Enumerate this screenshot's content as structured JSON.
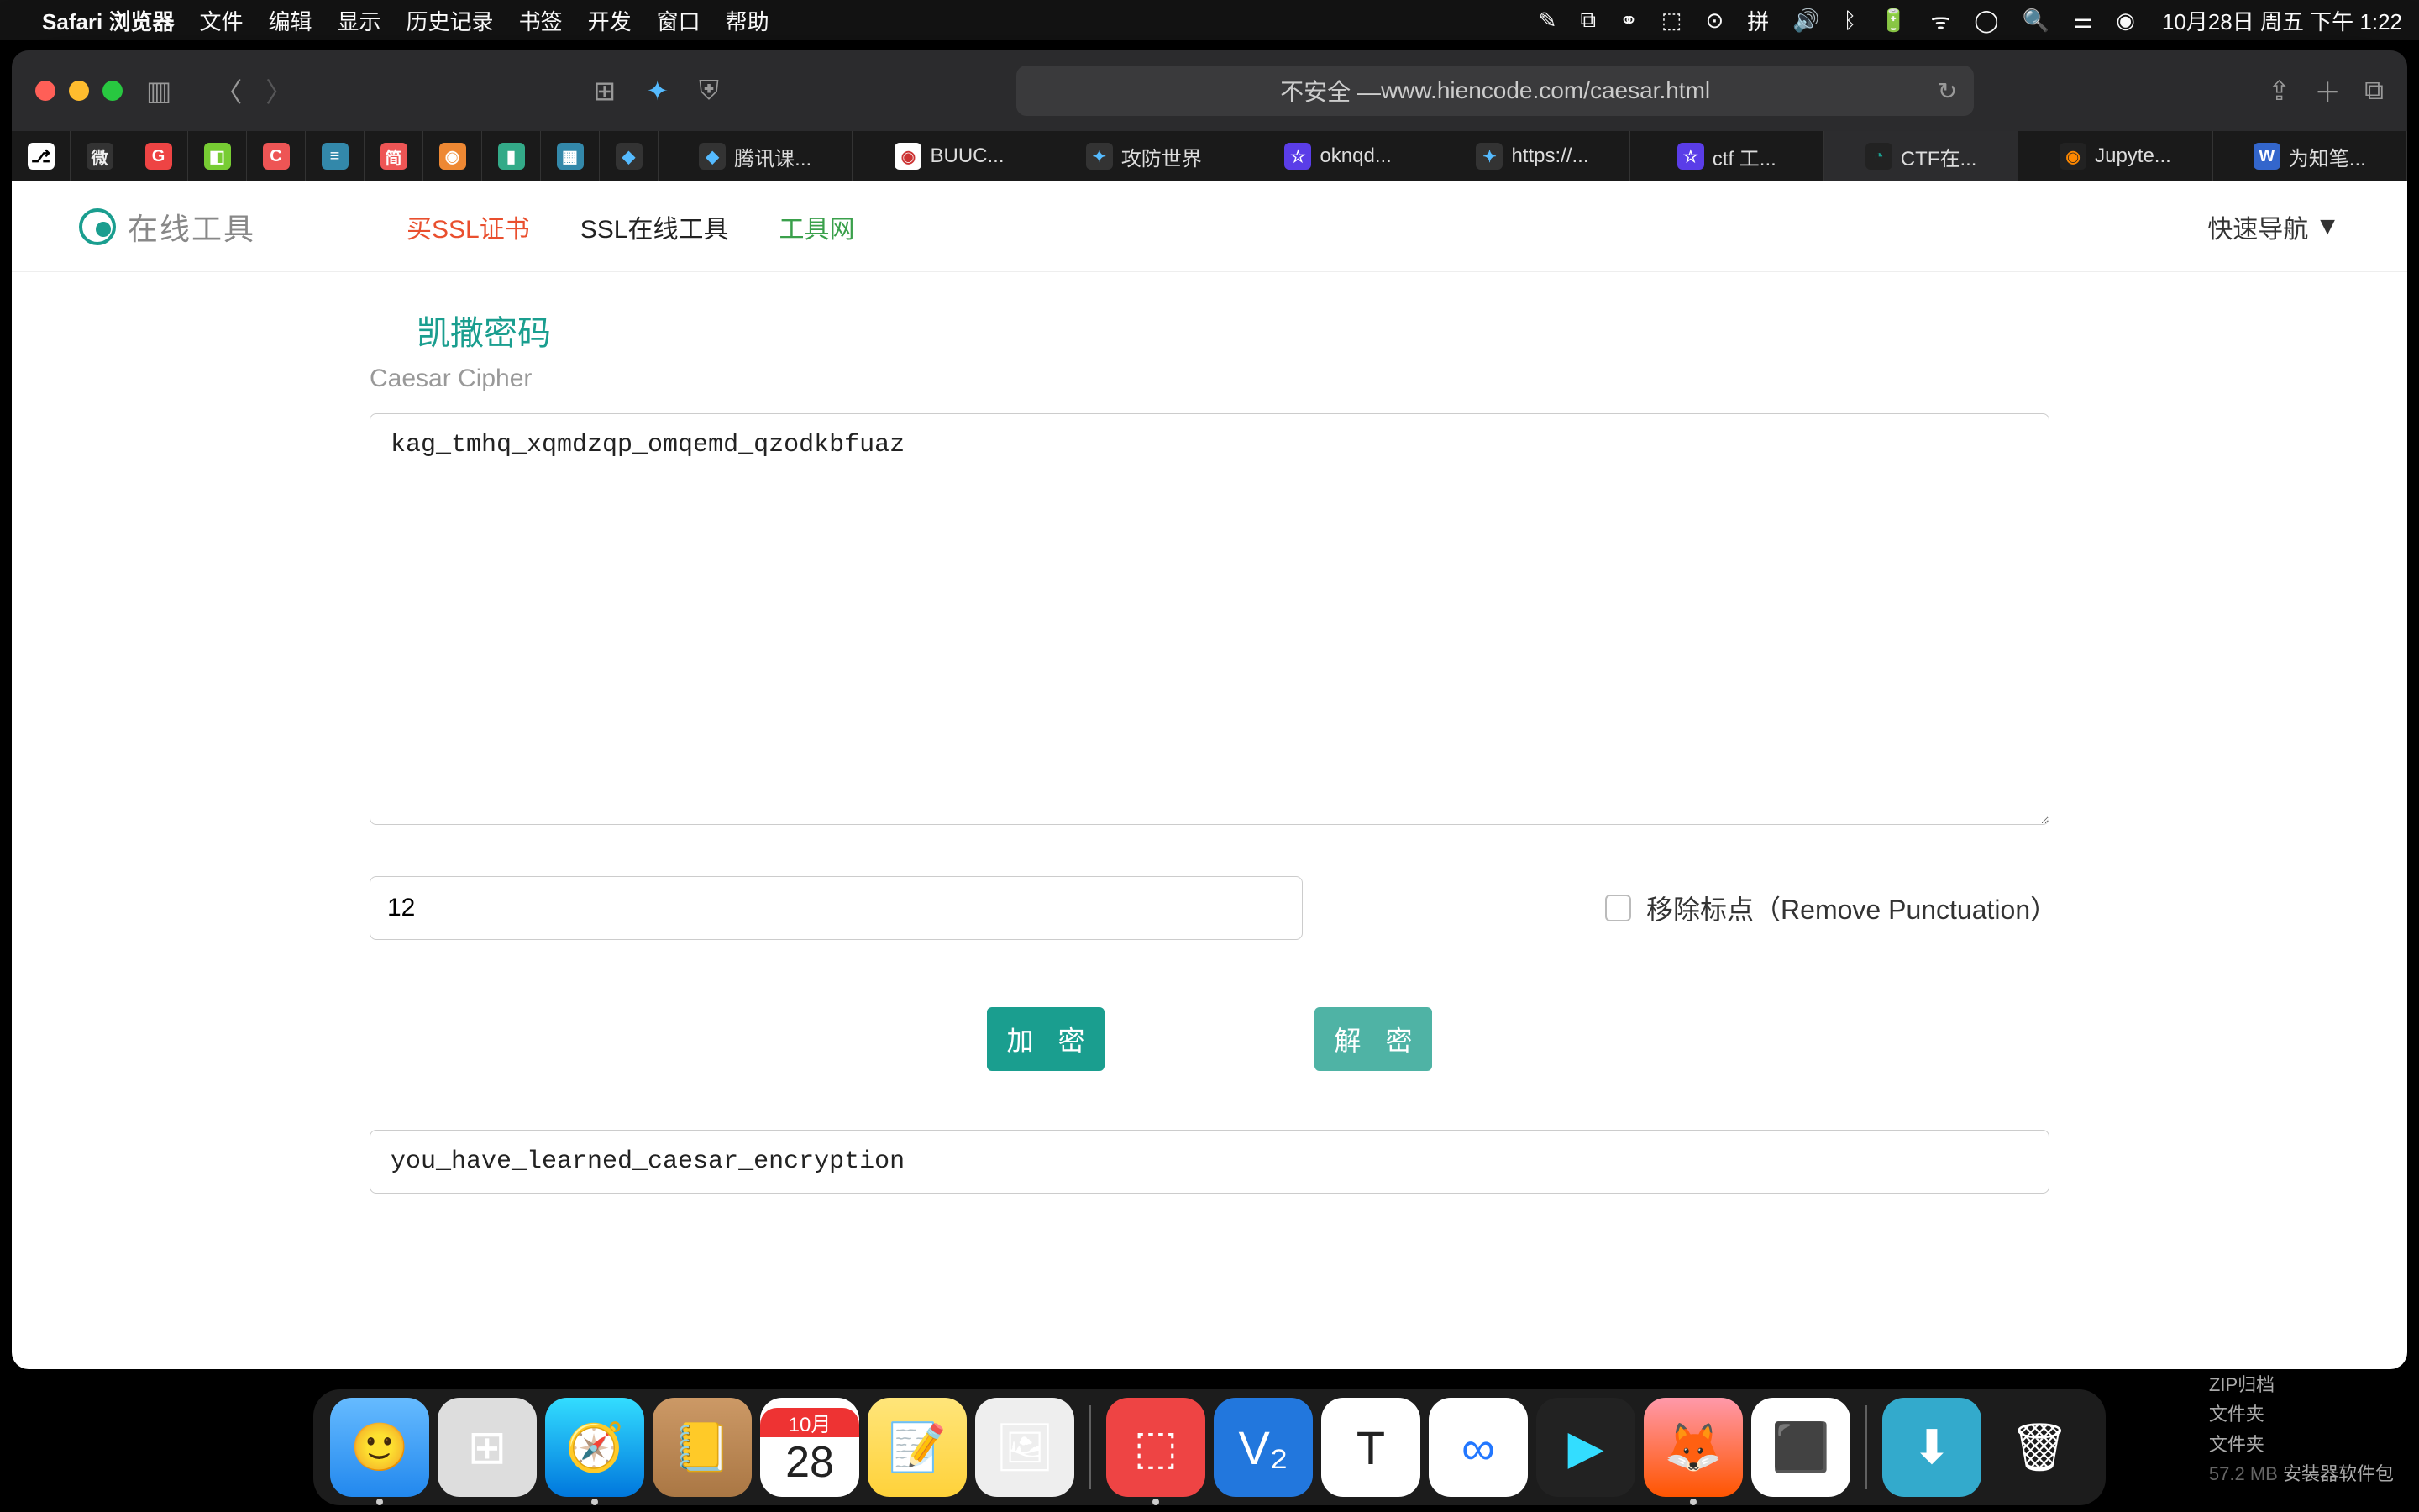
{
  "menubar": {
    "apple": "",
    "appname": "Safari 浏览器",
    "items": [
      "文件",
      "编辑",
      "显示",
      "历史记录",
      "书签",
      "开发",
      "窗口",
      "帮助"
    ],
    "datetime": "10月28日 周五 下午 1:22"
  },
  "safari": {
    "url_prefix": "不安全 — ",
    "url": "www.hiencode.com/caesar.html"
  },
  "tabs": [
    {
      "label": "",
      "icon_bg": "#fff",
      "icon_fg": "#000",
      "glyph": "⎇"
    },
    {
      "label": "",
      "icon_bg": "#333",
      "icon_fg": "#eee",
      "glyph": "微"
    },
    {
      "label": "",
      "icon_bg": "#e44",
      "icon_fg": "#fff",
      "glyph": "G"
    },
    {
      "label": "",
      "icon_bg": "#7c3",
      "icon_fg": "#fff",
      "glyph": "◧"
    },
    {
      "label": "",
      "icon_bg": "#e55",
      "icon_fg": "#fff",
      "glyph": "C"
    },
    {
      "label": "",
      "icon_bg": "#38a",
      "icon_fg": "#fff",
      "glyph": "≡"
    },
    {
      "label": "",
      "icon_bg": "#e55",
      "icon_fg": "#fff",
      "glyph": "简"
    },
    {
      "label": "",
      "icon_bg": "#e83",
      "icon_fg": "#fff",
      "glyph": "◉"
    },
    {
      "label": "",
      "icon_bg": "#3a8",
      "icon_fg": "#fff",
      "glyph": "▮"
    },
    {
      "label": "",
      "icon_bg": "#38a",
      "icon_fg": "#fff",
      "glyph": "▦"
    },
    {
      "label": "",
      "icon_bg": "#333",
      "icon_fg": "#5bf",
      "glyph": "◆"
    },
    {
      "label": "腾讯课...",
      "icon_bg": "#333",
      "icon_fg": "#5bf",
      "glyph": "◆",
      "wide": true
    },
    {
      "label": "BUUC...",
      "icon_bg": "#fff",
      "icon_fg": "#c33",
      "glyph": "◉",
      "wide": true
    },
    {
      "label": "攻防世界",
      "icon_bg": "#333",
      "icon_fg": "#5bf",
      "glyph": "✦",
      "wide": true
    },
    {
      "label": "oknqd...",
      "icon_bg": "#5a3de8",
      "icon_fg": "#fff",
      "glyph": "☆",
      "wide": true
    },
    {
      "label": "https://...",
      "icon_bg": "#333",
      "icon_fg": "#5bf",
      "glyph": "✦",
      "wide": true
    },
    {
      "label": "ctf 工...",
      "icon_bg": "#5a3de8",
      "icon_fg": "#fff",
      "glyph": "☆",
      "wide": true
    },
    {
      "label": "CTF在...",
      "icon_bg": "#222",
      "icon_fg": "#1a9e8f",
      "glyph": "◔",
      "wide": true,
      "active": true
    },
    {
      "label": "Jupyte...",
      "icon_bg": "#222",
      "icon_fg": "#f80",
      "glyph": "◉",
      "wide": true
    },
    {
      "label": "为知笔...",
      "icon_bg": "#36c",
      "icon_fg": "#fff",
      "glyph": "W",
      "wide": true
    }
  ],
  "page": {
    "site_name": "在线工具",
    "nav1": "买SSL证书",
    "nav2": "SSL在线工具",
    "nav3": "工具网",
    "quick_nav": "快速导航",
    "section_title": "凯撒密码",
    "section_sub": "Caesar Cipher",
    "input_text": "kag_tmhq_xqmdzqp_omqemd_qzodkbfuaz",
    "shift_value": "12",
    "remove_punct_label": "移除标点（Remove Punctuation）",
    "encrypt_btn": "加 密",
    "decrypt_btn": "解 密",
    "output_text": "you_have_learned_caesar_encryption"
  },
  "dock_side": {
    "line1a": "ZIP归档",
    "line1b": "",
    "line2": "文件夹",
    "line3a": "57.2 MB",
    "line3b": "安装器软件包",
    "line_extra": "文件夹"
  }
}
